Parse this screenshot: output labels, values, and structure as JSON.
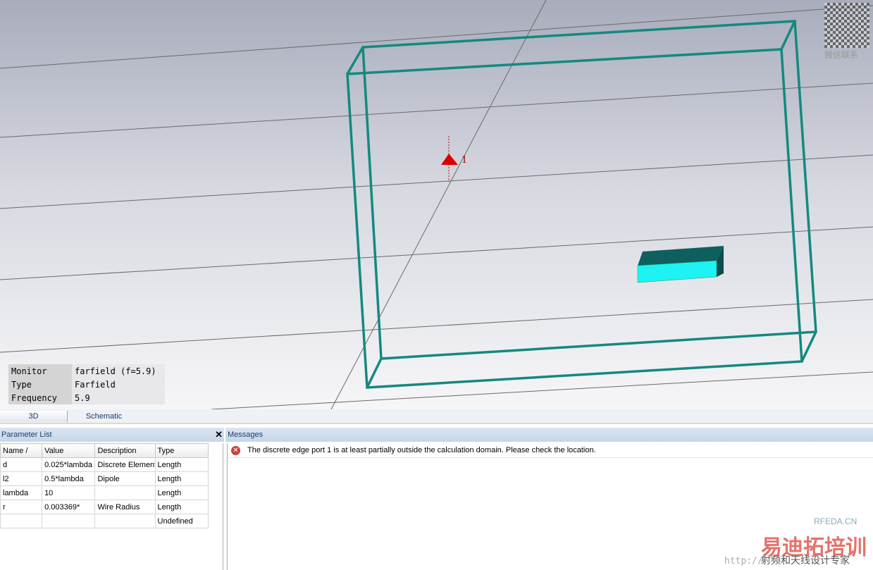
{
  "viewport": {
    "port_label": "1",
    "info": [
      {
        "key": "Monitor",
        "value": "farfield (f=5.9)"
      },
      {
        "key": "Type",
        "value": "Farfield"
      },
      {
        "key": "Frequency",
        "value": "5.9"
      }
    ]
  },
  "tabs": [
    {
      "label": "3D"
    },
    {
      "label": "Schematic"
    }
  ],
  "parameter_list": {
    "title": "Parameter List",
    "close": "✕",
    "headers": [
      "Name  /",
      "Value",
      "Description",
      "Type"
    ],
    "rows": [
      [
        "d",
        "0.025*lambda",
        "Discrete Element",
        "Length"
      ],
      [
        "l2",
        "0.5*lambda",
        "Dipole",
        "Length"
      ],
      [
        "lambda",
        "10",
        "",
        "Length"
      ],
      [
        "r",
        "0.003369*",
        "Wire Radius",
        "Length"
      ],
      [
        "",
        "",
        "",
        "Undefined"
      ]
    ]
  },
  "messages": {
    "title": "Messages",
    "items": [
      {
        "type": "error",
        "text": "The discrete edge port 1 is at least partially outside the calculation domain. Please check the location."
      }
    ]
  },
  "watermark": {
    "qr_text": "微信联系",
    "brand": "易迪拓培训",
    "site": "RFEDA.CN",
    "slogan": "射频和天线设计专家",
    "url": "http://"
  }
}
